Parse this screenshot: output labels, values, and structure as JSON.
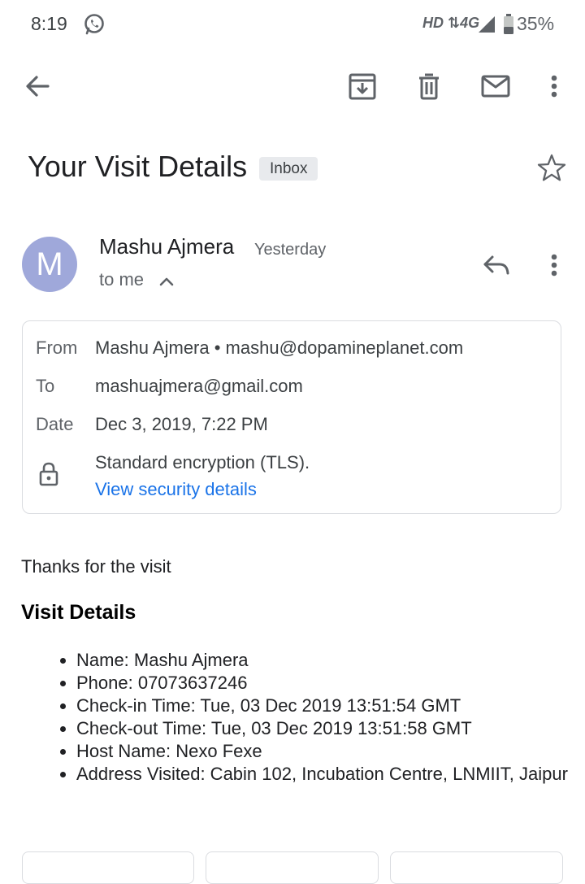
{
  "status_bar": {
    "time": "8:19",
    "network": "HD ⇅4G",
    "battery": "35%",
    "icons": [
      "whatsapp-icon",
      "signal-icon",
      "battery-icon"
    ]
  },
  "toolbar": {
    "icons": [
      "back-arrow-icon",
      "archive-icon",
      "delete-icon",
      "mark-unread-icon",
      "more-vert-icon"
    ]
  },
  "email": {
    "subject": "Your Visit Details",
    "label": "Inbox",
    "sender_initial": "M",
    "sender_name": "Mashu Ajmera",
    "received": "Yesterday",
    "to_me": "to me"
  },
  "details": {
    "from_label": "From",
    "from_value": "Mashu Ajmera • mashu@dopamineplanet.com",
    "to_label": "To",
    "to_value": "mashuajmera@gmail.com",
    "date_label": "Date",
    "date_value": "Dec 3, 2019, 7:22 PM",
    "encryption": "Standard encryption (TLS).",
    "security_link": "View security details"
  },
  "body": {
    "intro": "Thanks for the visit",
    "heading": "Visit Details",
    "items": [
      "Name: Mashu Ajmera",
      "Phone: 07073637246",
      "Check-in Time: Tue, 03 Dec 2019 13:51:54 GMT",
      "Check-out Time: Tue, 03 Dec 2019 13:51:58 GMT",
      "Host Name: Nexo Fexe",
      "Address Visited: Cabin 102, Incubation Centre, LNMIIT, Jaipur"
    ]
  },
  "colors": {
    "accent_link": "#1a73e8",
    "avatar_bg": "#9fa8da",
    "label_chip_bg": "#e8eaed",
    "icon_gray": "#5f6368"
  }
}
